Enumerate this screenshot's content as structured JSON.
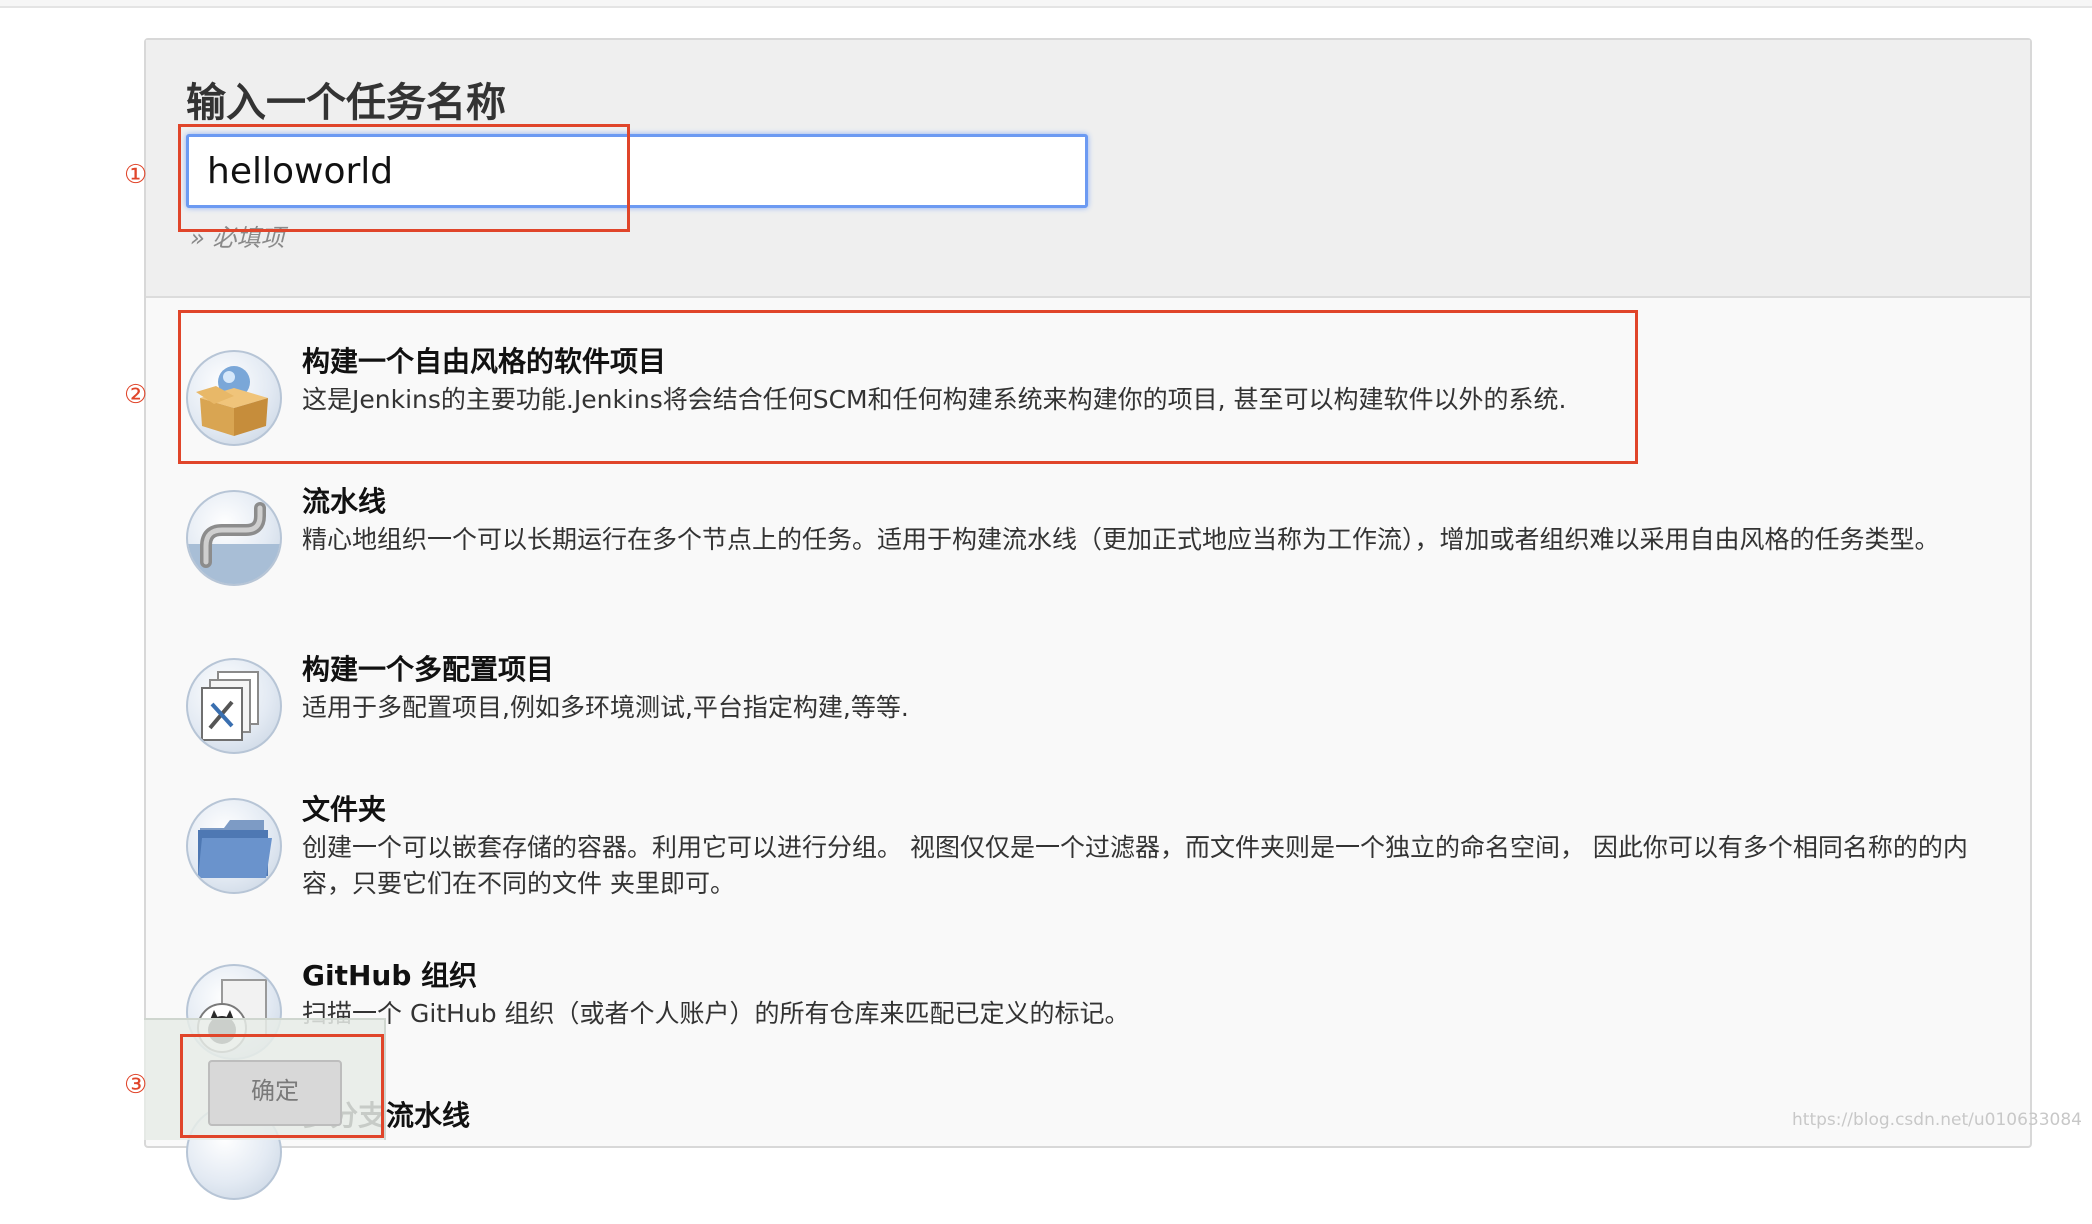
{
  "form": {
    "title": "输入一个任务名称",
    "name_value": "helloworld",
    "required_hint": "» 必填项"
  },
  "items": [
    {
      "title": "构建一个自由风格的软件项目",
      "desc": "这是Jenkins的主要功能.Jenkins将会结合任何SCM和任何构建系统来构建你的项目, 甚至可以构建软件以外的系统.",
      "icon": "freestyle-box-icon"
    },
    {
      "title": "流水线",
      "desc": "精心地组织一个可以长期运行在多个节点上的任务。适用于构建流水线（更加正式地应当称为工作流），增加或者组织难以采用自由风格的任务类型。",
      "icon": "pipeline-icon"
    },
    {
      "title": "构建一个多配置项目",
      "desc": "适用于多配置项目,例如多环境测试,平台指定构建,等等.",
      "icon": "multi-config-icon"
    },
    {
      "title": "文件夹",
      "desc": "创建一个可以嵌套存储的容器。利用它可以进行分组。 视图仅仅是一个过滤器，而文件夹则是一个独立的命名空间， 因此你可以有多个相同名称的的内容，只要它们在不同的文件 夹里即可。",
      "icon": "folder-icon"
    },
    {
      "title": "GitHub 组织",
      "desc": "扫描一个 GitHub 组织（或者个人账户）的所有仓库来匹配已定义的标记。",
      "icon": "github-org-icon"
    },
    {
      "title": "多分支流水线",
      "desc": "",
      "icon": "multibranch-icon"
    }
  ],
  "annotations": {
    "n1": "①",
    "n2": "②",
    "n3": "③"
  },
  "footer": {
    "ok_label": "确定"
  },
  "watermark": "https://blog.csdn.net/u010633084",
  "colors": {
    "annotation": "#e0452a",
    "input_focus": "#6c9af2"
  }
}
